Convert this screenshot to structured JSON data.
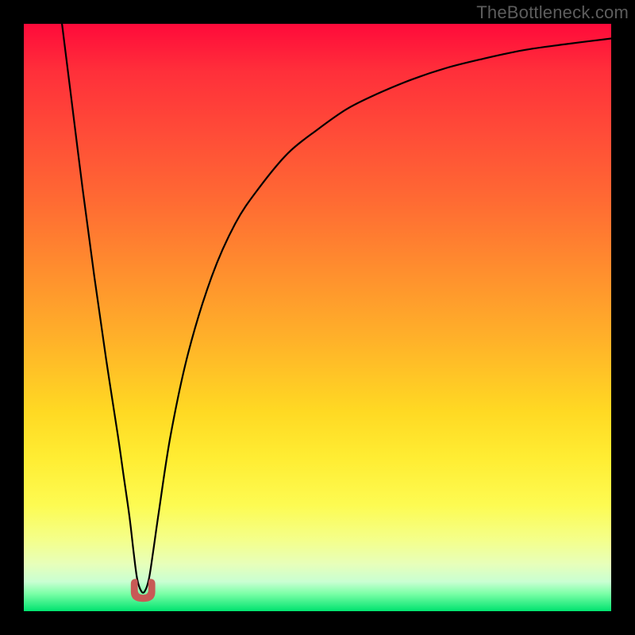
{
  "watermark": "TheBottleneck.com",
  "colors": {
    "frame": "#000000",
    "curve": "#000000",
    "marker": "#c85a56"
  },
  "chart_data": {
    "type": "line",
    "title": "",
    "xlabel": "",
    "ylabel": "",
    "xlim": [
      0,
      100
    ],
    "ylim": [
      0,
      100
    ],
    "x": [
      6.5,
      8,
      10,
      12,
      14,
      16,
      17,
      18,
      18.7,
      19.3,
      20,
      20.6,
      21.3,
      22,
      23,
      25,
      28,
      32,
      36,
      40,
      45,
      50,
      55,
      60,
      66,
      72,
      78,
      85,
      92,
      100
    ],
    "values": [
      100,
      88,
      72,
      57,
      43,
      30,
      23,
      16,
      10,
      5.5,
      3.4,
      3.4,
      5.5,
      10,
      17,
      30,
      44,
      57,
      66,
      72,
      78,
      82,
      85.5,
      88,
      90.5,
      92.5,
      94,
      95.5,
      96.5,
      97.5
    ],
    "annotations": [
      {
        "type": "marker",
        "shape": "u",
        "x_center": 20.3,
        "y": 3.0,
        "width": 2.4,
        "note": "bottleneck minimum highlight"
      }
    ],
    "background_gradient_stops": [
      {
        "pos": 0.0,
        "hex": "#ff0a3a"
      },
      {
        "pos": 0.3,
        "hex": "#ff6a33"
      },
      {
        "pos": 0.66,
        "hex": "#ffd923"
      },
      {
        "pos": 0.88,
        "hex": "#f4ff8c"
      },
      {
        "pos": 1.0,
        "hex": "#00e36f"
      }
    ]
  }
}
